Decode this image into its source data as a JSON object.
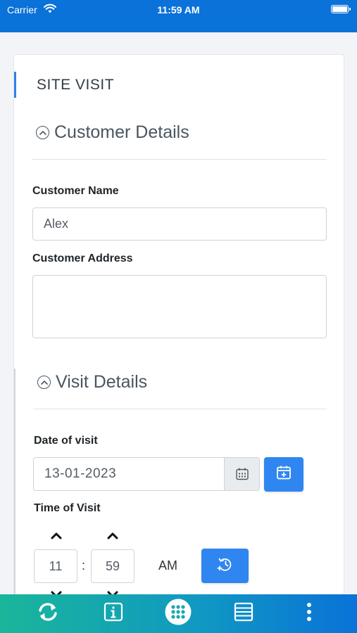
{
  "status_bar": {
    "carrier": "Carrier",
    "time": "11:59 AM"
  },
  "card": {
    "title": "SITE VISIT"
  },
  "customer_details": {
    "heading": "Customer Details",
    "name_label": "Customer Name",
    "name_value": "Alex",
    "address_label": "Customer Address",
    "address_value": ""
  },
  "visit_details": {
    "heading": "Visit Details",
    "date_label": "Date of visit",
    "date_value": "13-01-2023",
    "time_label": "Time of Visit",
    "hour": "11",
    "separator": ":",
    "minute": "59",
    "meridian": "AM"
  },
  "bottom_nav": {
    "items": [
      {
        "icon": "sync-icon"
      },
      {
        "icon": "info-icon"
      },
      {
        "icon": "apps-grid-icon"
      },
      {
        "icon": "list-icon"
      },
      {
        "icon": "more-vertical-icon"
      }
    ]
  },
  "colors": {
    "status_bar": "#0a72d8",
    "accent": "#2f86f0",
    "nav_start": "#1ab69a",
    "nav_end": "#0a72d8"
  }
}
